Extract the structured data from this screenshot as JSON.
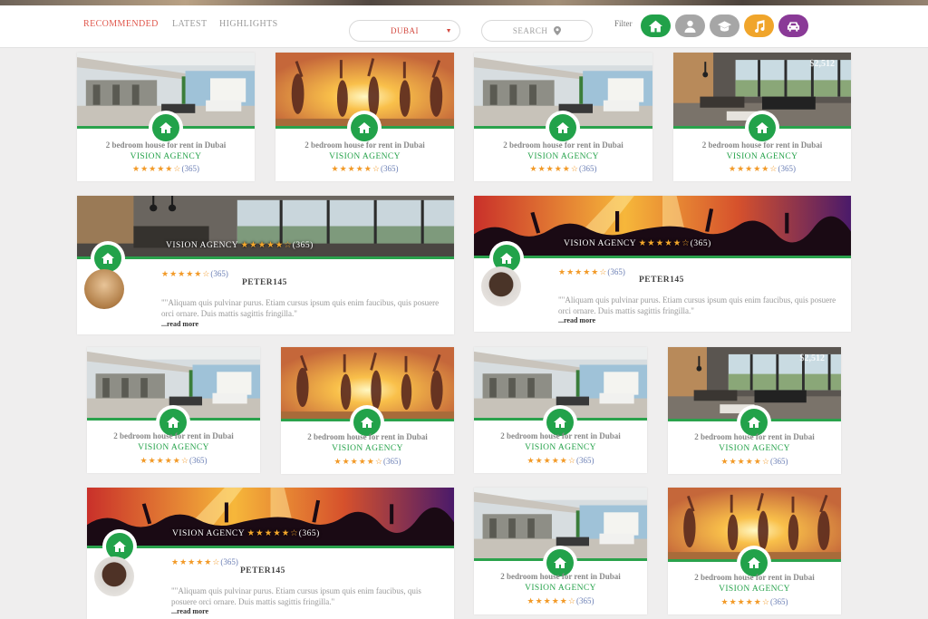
{
  "nav": {
    "tabs": [
      "RECOMMENDED",
      "LATEST",
      "HIGHLIGHTS"
    ],
    "active_tab": "RECOMMENDED",
    "city_select": "DUBAI",
    "search_label": "SEARCH",
    "filter_label": "Filter",
    "filters": [
      {
        "icon": "home-icon",
        "color": "#21a149"
      },
      {
        "icon": "user-icon",
        "color": "#a6a6a6"
      },
      {
        "icon": "graduation-cap-icon",
        "color": "#a6a6a6"
      },
      {
        "icon": "music-icon",
        "color": "#f0a52b"
      },
      {
        "icon": "car-icon",
        "color": "#8a3a97"
      }
    ]
  },
  "listing": {
    "title": "2 bedroom house for rent in Dubai",
    "agency": "VISION AGENCY",
    "stars": "★★★★★☆",
    "count": "(365)",
    "price": "$2,512"
  },
  "wide": {
    "agency": "VISION AGENCY",
    "stars": "★★★★★☆",
    "count": "(365)",
    "author": "PETER145",
    "quote": "\"\"Aliquam quis pulvinar purus. Etiam cursus ipsum quis enim faucibus, quis posuere orci ornare. Duis mattis sagittis fringilla.\"",
    "read_more": "...read more"
  },
  "colors": {
    "green": "#22a24a",
    "star": "#f29a28",
    "accent": "#e0574c"
  }
}
